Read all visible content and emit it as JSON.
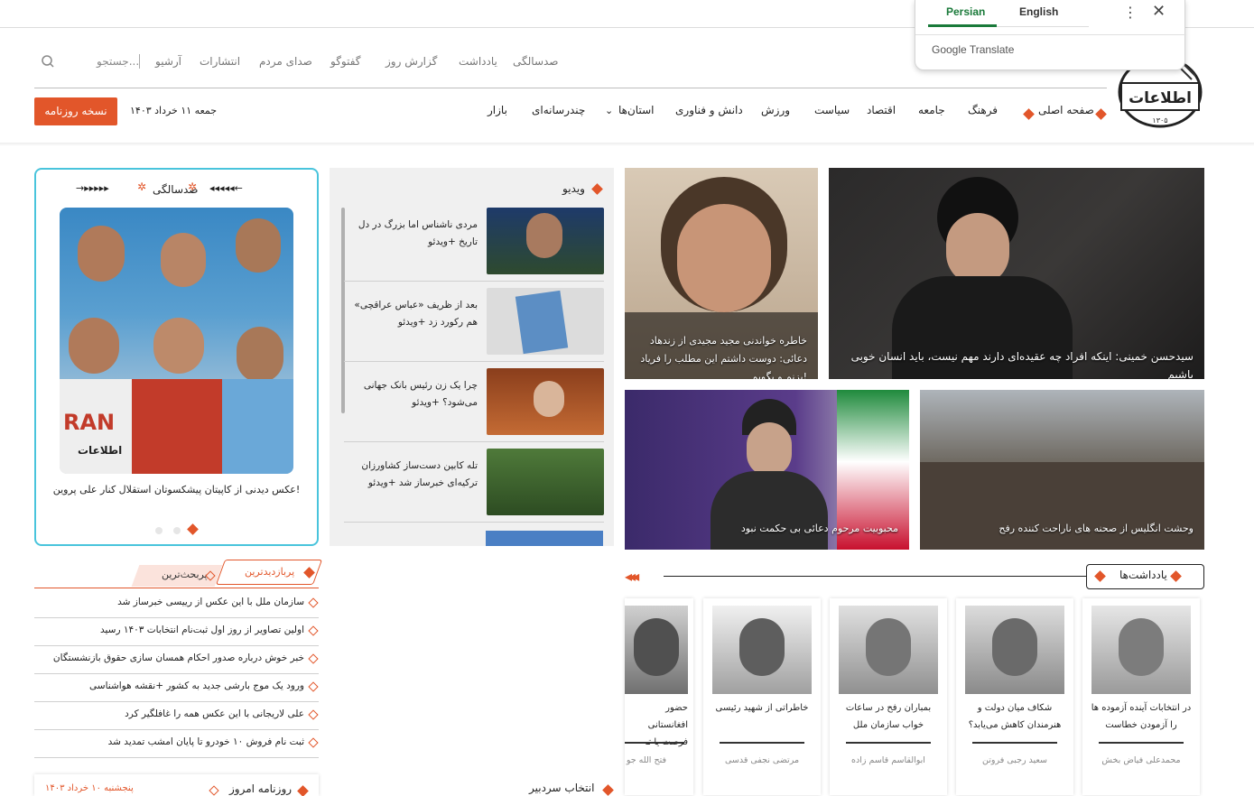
{
  "translate_popup": {
    "tab_persian": "Persian",
    "tab_english": "English",
    "brand": "Google Translate"
  },
  "secondary_nav": {
    "items": [
      "صدسالگی",
      "یادداشت",
      "گزارش روز",
      "گفتوگو",
      "صدای مردم",
      "انتشارات",
      "آرشیو"
    ],
    "search_placeholder": "جستجو..."
  },
  "main_nav": {
    "items": [
      "صفحه اصلی",
      "فرهنگ",
      "جامعه",
      "اقتصاد",
      "سیاست",
      "ورزش",
      "دانش و فناوری",
      "استان‌ها",
      "چندرسانه‌ای",
      "بازار"
    ],
    "date": "جمعه ۱۱ خرداد ۱۴۰۳",
    "paper_button": "نسخه روزنامه"
  },
  "logo": {
    "text": "اطلاعات",
    "year": "۱۳۰۵"
  },
  "top_stories": [
    {
      "caption": "سیدحسن خمینی: اینکه افراد چه عقیده‌ای دارند مهم نیست، باید انسان خوبی باشیم"
    },
    {
      "caption": "خاطره خواندنی مجید مجیدی از زندهاد دعائی: دوست داشتم این مطلب را فریاد بزنم و بگویم!"
    },
    {
      "caption": "وحشت انگلیس از صحنه های ناراحت کننده رفح"
    },
    {
      "caption": "محبوبیت مرحوم دعائی بی حکمت نبود"
    }
  ],
  "video": {
    "title": "ویدیو",
    "items": [
      "مردی ناشناس اما بزرگ در دل تاریخ +ویدئو",
      "بعد از ظریف «عباس عراقچی» هم رکورد زد +ویدئو",
      "چرا یک زن رئیس بانک جهانی می‌شود؟ +ویدئو",
      "تله کابین دست‌ساز کشاورزان ترکیه‌ای خبرساز شد +ویدئو"
    ]
  },
  "centenary": {
    "title": "صدسالگی",
    "photo_caption": "عکس دیدنی از کاپیتان پیشکسوتان استقلال کنار علی پروین!",
    "shirt_text": "RAN",
    "photo_logo": "اطلاعات"
  },
  "most": {
    "tab_viewed": "پربازدیدترین",
    "tab_commented": "پربحث‌ترین",
    "items": [
      "سازمان ملل با این عکس از رییسی خبرساز شد",
      "اولین تصاویر از روز اول ثبت‌نام انتخابات ۱۴۰۳ رسید",
      "خبر خوش درباره صدور احکام همسان سازی حقوق بازنشستگان",
      "ورود یک موج بارشی جدید به کشور +نقشه هواشناسی",
      "علی لاریجانی با این عکس همه را غافلگیر کرد",
      "ثبت نام فروش ۱۰ خودرو تا پایان امشب تمدید شد"
    ]
  },
  "notes": {
    "title": "یادداشت‌ها",
    "cards": [
      {
        "title": "در انتخابات آینده آزموده ها را آزمودن خطاست",
        "author": "محمدعلی فیاض بخش"
      },
      {
        "title": "شکاف میان دولت و هنرمندان کاهش می‌یابد؟",
        "author": "سعید رجبی فروتن"
      },
      {
        "title": "بمباران رفح در ساعات خواب سازمان ملل",
        "author": "ابوالقاسم قاسم زاده"
      },
      {
        "title": "خاطراتی از شهید رئیسی",
        "author": "مرتضی نجفی قدسی"
      },
      {
        "title": "حضور افغانستانی فرصت یا تـ",
        "author": "فتح الله جو"
      }
    ]
  },
  "bottom": {
    "newspaper_title": "روزنامه امروز",
    "newspaper_date": "پنجشنبه ۱۰ خرداد ۱۴۰۳",
    "editor_pick": "انتخاب سردبیر"
  },
  "colors": {
    "accent": "#e2562a",
    "cyan": "#49c4dc"
  }
}
